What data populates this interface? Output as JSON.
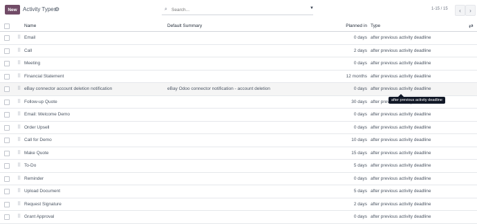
{
  "toolbar": {
    "new_label": "New",
    "title": "Activity Types",
    "gear_icon": "gear-icon",
    "search_placeholder": "Search...",
    "pager_text": "1-15 / 15",
    "prev": "‹",
    "next": "›"
  },
  "columns": {
    "name": "Name",
    "summary": "Default Summary",
    "planned": "Planned in",
    "type": "Type"
  },
  "rows": [
    {
      "name": "Email",
      "summary": "",
      "planned": "0 days",
      "type": "after previous activity deadline"
    },
    {
      "name": "Call",
      "summary": "",
      "planned": "2 days",
      "type": "after previous activity deadline"
    },
    {
      "name": "Meeting",
      "summary": "",
      "planned": "0 days",
      "type": "after previous activity deadline"
    },
    {
      "name": "Financial Statement",
      "summary": "",
      "planned": "12 months",
      "type": "after previous activity deadline"
    },
    {
      "name": "eBay connector account deletion notification",
      "summary": "eBay Odoo connector notification - account deletion",
      "planned": "0 days",
      "type": "after previous activity deadline"
    },
    {
      "name": "Follow-up Quote",
      "summary": "",
      "planned": "30 days",
      "type": "after previous activity deadline"
    },
    {
      "name": "Email: Welcome Demo",
      "summary": "",
      "planned": "0 days",
      "type": "after previous activity deadline"
    },
    {
      "name": "Order Upsell",
      "summary": "",
      "planned": "0 days",
      "type": "after previous activity deadline"
    },
    {
      "name": "Call for Demo",
      "summary": "",
      "planned": "10 days",
      "type": "after previous activity deadline"
    },
    {
      "name": "Make Quote",
      "summary": "",
      "planned": "15 days",
      "type": "after previous activity deadline"
    },
    {
      "name": "To-Do",
      "summary": "",
      "planned": "5 days",
      "type": "after previous activity deadline"
    },
    {
      "name": "Reminder",
      "summary": "",
      "planned": "0 days",
      "type": "after previous activity deadline"
    },
    {
      "name": "Upload Document",
      "summary": "",
      "planned": "5 days",
      "type": "after previous activity deadline"
    },
    {
      "name": "Request Signature",
      "summary": "",
      "planned": "2 days",
      "type": "after previous activity deadline"
    },
    {
      "name": "Grant Approval",
      "summary": "",
      "planned": "0 days",
      "type": "after previous activity deadline"
    }
  ],
  "tooltip": "after previous activity deadline"
}
